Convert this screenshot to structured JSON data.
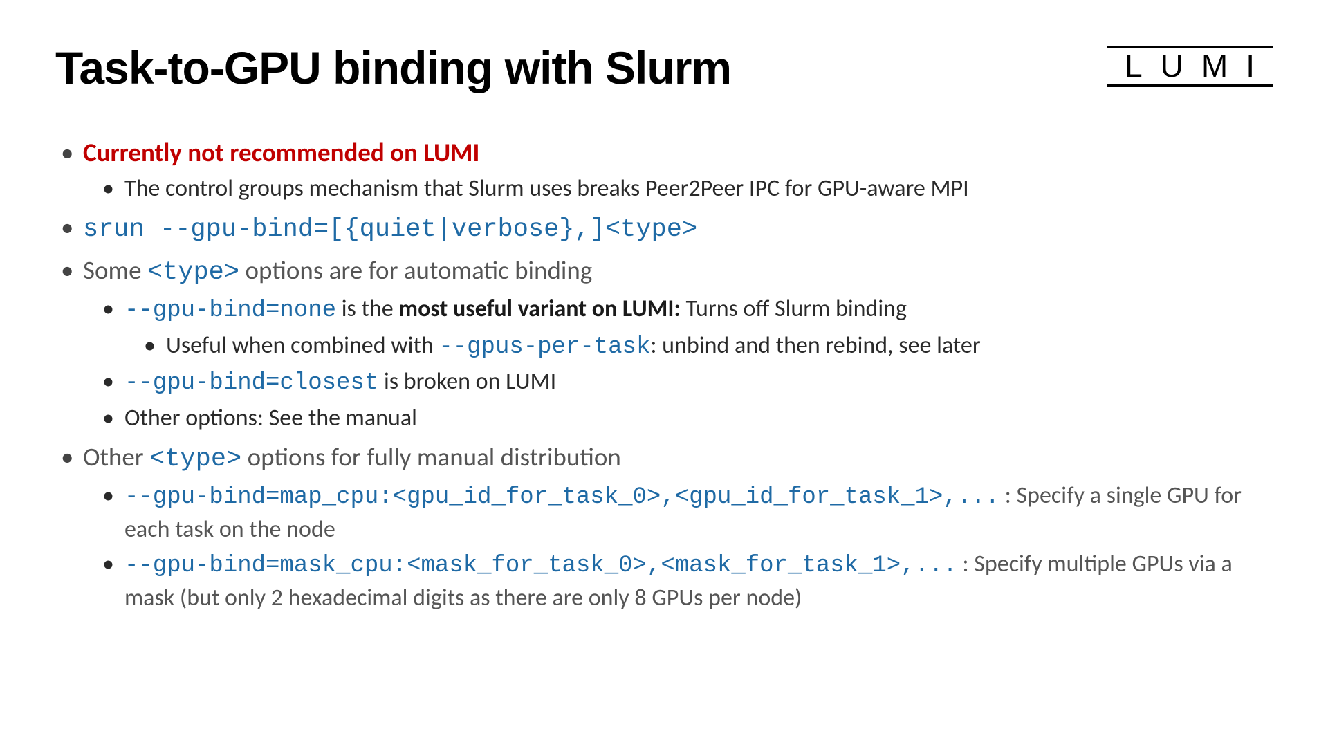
{
  "title": "Task-to-GPU binding with Slurm",
  "logo": "LUMI",
  "warn_line": "Currently not recommended on LUMI",
  "warn_sub": "The control groups mechanism that Slurm uses breaks Peer2Peer IPC for GPU-aware MPI",
  "srun_line": "srun --gpu-bind=[{quiet|verbose},]<type>",
  "auto_line_prefix": "Some ",
  "type_token": "<type>",
  "auto_line_suffix": " options are for automatic binding",
  "none_cmd": "--gpu-bind=none",
  "none_mid": " is the ",
  "none_bold": "most useful variant on LUMI:",
  "none_suffix": " Turns off Slurm binding",
  "none_sub_prefix": "Useful when combined with ",
  "gpus_per_task": "--gpus-per-task",
  "none_sub_suffix": ": unbind and then rebind, see later",
  "closest_cmd": "--gpu-bind=closest",
  "closest_suffix": " is broken on LUMI",
  "other_options": "Other options: See the manual",
  "manual_line_prefix": "Other ",
  "manual_line_suffix": " options for fully manual distribution",
  "map_cmd": "--gpu-bind=map_cpu:<gpu_id_for_task_0>,<gpu_id_for_task_1>,...",
  "map_suffix": " : Specify a single GPU for each task on the node",
  "mask_cmd": "--gpu-bind=mask_cpu:<mask_for_task_0>,<mask_for_task_1>,...",
  "mask_suffix": " : Specify multiple GPUs via a mask (but only 2 hexadecimal digits as there are only 8 GPUs per node)"
}
